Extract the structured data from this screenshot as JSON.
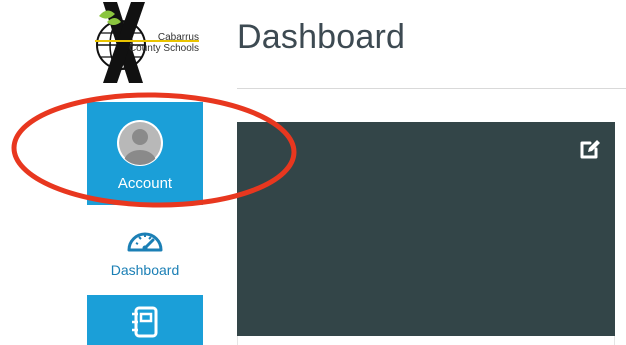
{
  "logo": {
    "line1": "Cabarrus",
    "line2": "County Schools"
  },
  "header": {
    "title": "Dashboard"
  },
  "sidebar": {
    "items": [
      {
        "label": "Account",
        "icon": "avatar-icon",
        "active": true
      },
      {
        "label": "Dashboard",
        "icon": "dashboard-gauge-icon"
      },
      {
        "label": "",
        "icon": "notebook-icon"
      }
    ]
  },
  "card": {
    "edit_icon": "edit-icon"
  },
  "colors": {
    "accent": "#1b9fd8",
    "card_bg": "#334548",
    "annotation": "#e8371f"
  }
}
